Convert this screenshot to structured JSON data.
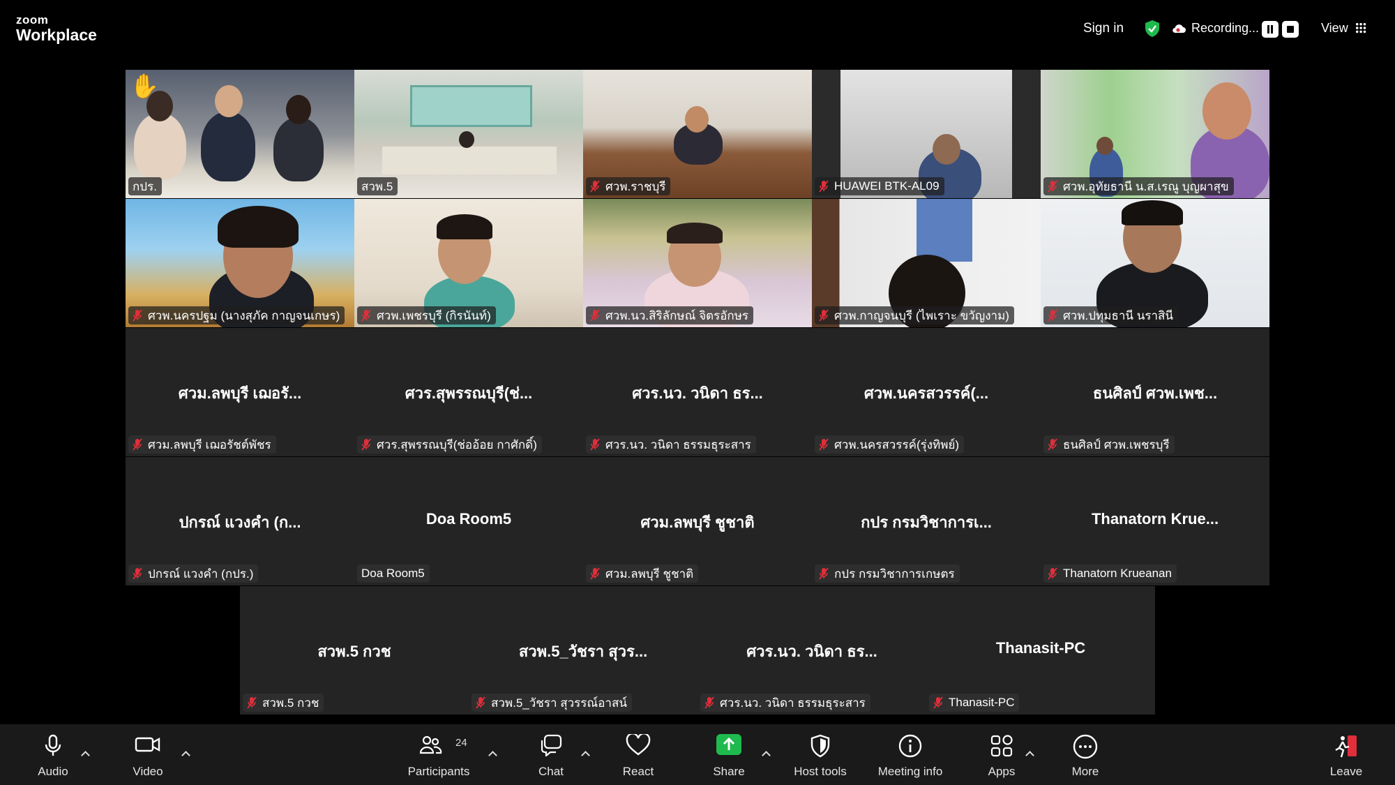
{
  "topbar": {
    "logo_line1": "zoom",
    "logo_line2": "Workplace",
    "sign_in": "Sign in",
    "recording": "Recording...",
    "view": "View",
    "shield_color": "#1fba4e"
  },
  "gallery": {
    "tiles": [
      {
        "label": "กปร.",
        "video": true,
        "raised_hand": true,
        "active_speaker": true,
        "muted": false
      },
      {
        "label": "สวพ.5",
        "video": true,
        "muted": false
      },
      {
        "label": "ศวพ.ราชบุรี",
        "video": true,
        "muted": true
      },
      {
        "label": "HUAWEI BTK-AL09",
        "video": true,
        "muted": true
      },
      {
        "label": "ศวพ.อุทัยธานี น.ส.เรณู บุญผาสุข",
        "video": true,
        "muted": true
      },
      {
        "label": "ศวพ.นครปฐม (นางสุภัค กาญจนเกษร)",
        "video": true,
        "muted": true
      },
      {
        "label": "ศวพ.เพชรบุรี (กิรนันท์)",
        "video": true,
        "muted": true
      },
      {
        "label": "ศวพ.นว.สิริลักษณ์ จิตรอักษร",
        "video": true,
        "muted": true
      },
      {
        "label": "ศวพ.กาญจนบุรี (ไพเราะ ขวัญงาม)",
        "video": true,
        "muted": true
      },
      {
        "label": "ศวพ.ปทุมธานี นราสินี",
        "video": true,
        "muted": true
      },
      {
        "big": "ศวม.ลพบุรี เฌอรั...",
        "label": "ศวม.ลพบุรี เฌอรัชต์พัชร",
        "muted": true
      },
      {
        "big": "ศวร.สุพรรณบุรี(ช่...",
        "label": "ศวร.สุพรรณบุรี(ช่ออ้อย กาศักดิ์)",
        "muted": true
      },
      {
        "big": "ศวร.นว. วนิดา ธร...",
        "label": "ศวร.นว. วนิดา ธรรมธุระสาร",
        "muted": true
      },
      {
        "big": "ศวพ.นครสวรรค์(...",
        "label": "ศวพ.นครสวรรค์(รุ่งทิพย์)",
        "muted": true
      },
      {
        "big": "ธนศิลป์ ศวพ.เพช...",
        "label": "ธนศิลป์ ศวพ.เพชรบุรี",
        "muted": true
      },
      {
        "big": "ปกรณ์ แวงคำ (ก...",
        "label": "ปกรณ์ แวงคำ (กปร.)",
        "muted": true
      },
      {
        "big": "Doa Room5",
        "label": "Doa Room5",
        "muted": false
      },
      {
        "big": "ศวม.ลพบุรี ชูชาติ",
        "label": "ศวม.ลพบุรี ชูชาติ",
        "muted": true
      },
      {
        "big": "กปร กรมวิชาการเ...",
        "label": "กปร กรมวิชาการเกษตร",
        "muted": true
      },
      {
        "big": "Thanatorn Krue...",
        "label": "Thanatorn Krueanan",
        "muted": true
      },
      {
        "big": "สวพ.5 กวช",
        "label": "สวพ.5 กวช",
        "muted": true
      },
      {
        "big": "สวพ.5_วัชรา สุวร...",
        "label": "สวพ.5_วัชรา สุวรรณ์อาสน์",
        "muted": true
      },
      {
        "big": "ศวร.นว. วนิดา ธร...",
        "label": "ศวร.นว. วนิดา ธรรมธุระสาร",
        "muted": true
      },
      {
        "big": "Thanasit-PC",
        "label": "Thanasit-PC",
        "muted": true
      }
    ]
  },
  "toolbar": {
    "audio": "Audio",
    "video": "Video",
    "participants": "Participants",
    "participants_count": "24",
    "chat": "Chat",
    "react": "React",
    "share": "Share",
    "host_tools": "Host tools",
    "meeting_info": "Meeting info",
    "apps": "Apps",
    "more": "More",
    "leave": "Leave",
    "share_color": "#1fba4e",
    "leave_color": "#e02f3b"
  }
}
